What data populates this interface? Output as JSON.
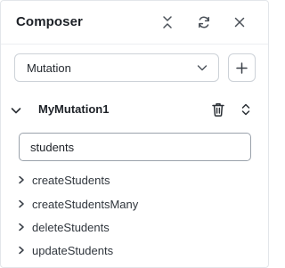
{
  "header": {
    "title": "Composer"
  },
  "operation_type": {
    "selected": "Mutation"
  },
  "operation": {
    "name": "MyMutation1",
    "expanded": true
  },
  "search": {
    "value": "students"
  },
  "fields": [
    {
      "label": "createStudents"
    },
    {
      "label": "createStudentsMany"
    },
    {
      "label": "deleteStudents"
    },
    {
      "label": "updateStudents"
    }
  ],
  "colors": {
    "text": "#1d2127",
    "border": "#cdd2d8",
    "icon": "#4a5058"
  }
}
